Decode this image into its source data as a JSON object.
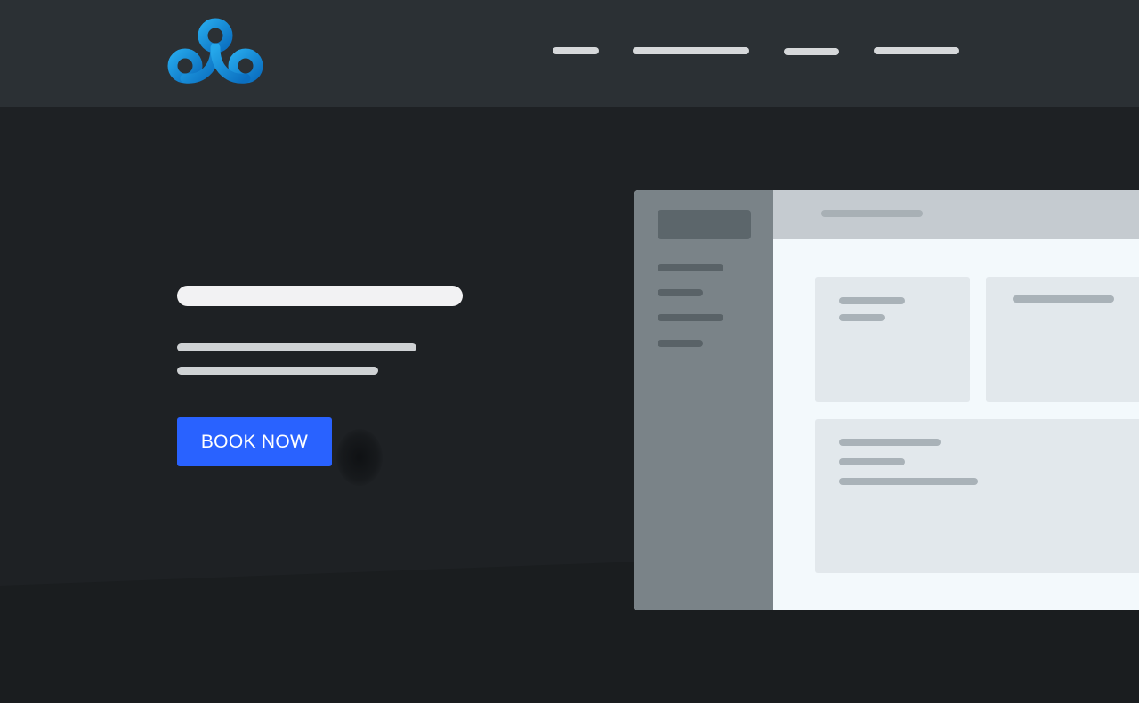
{
  "hero": {
    "cta_label": "BOOK NOW"
  },
  "icons": {
    "logo": "cloud9-logo-icon"
  },
  "colors": {
    "header_bg": "#2b3034",
    "page_bg": "#1e2124",
    "accent": "#2962ff",
    "logo_blue": "#1a9be0"
  }
}
